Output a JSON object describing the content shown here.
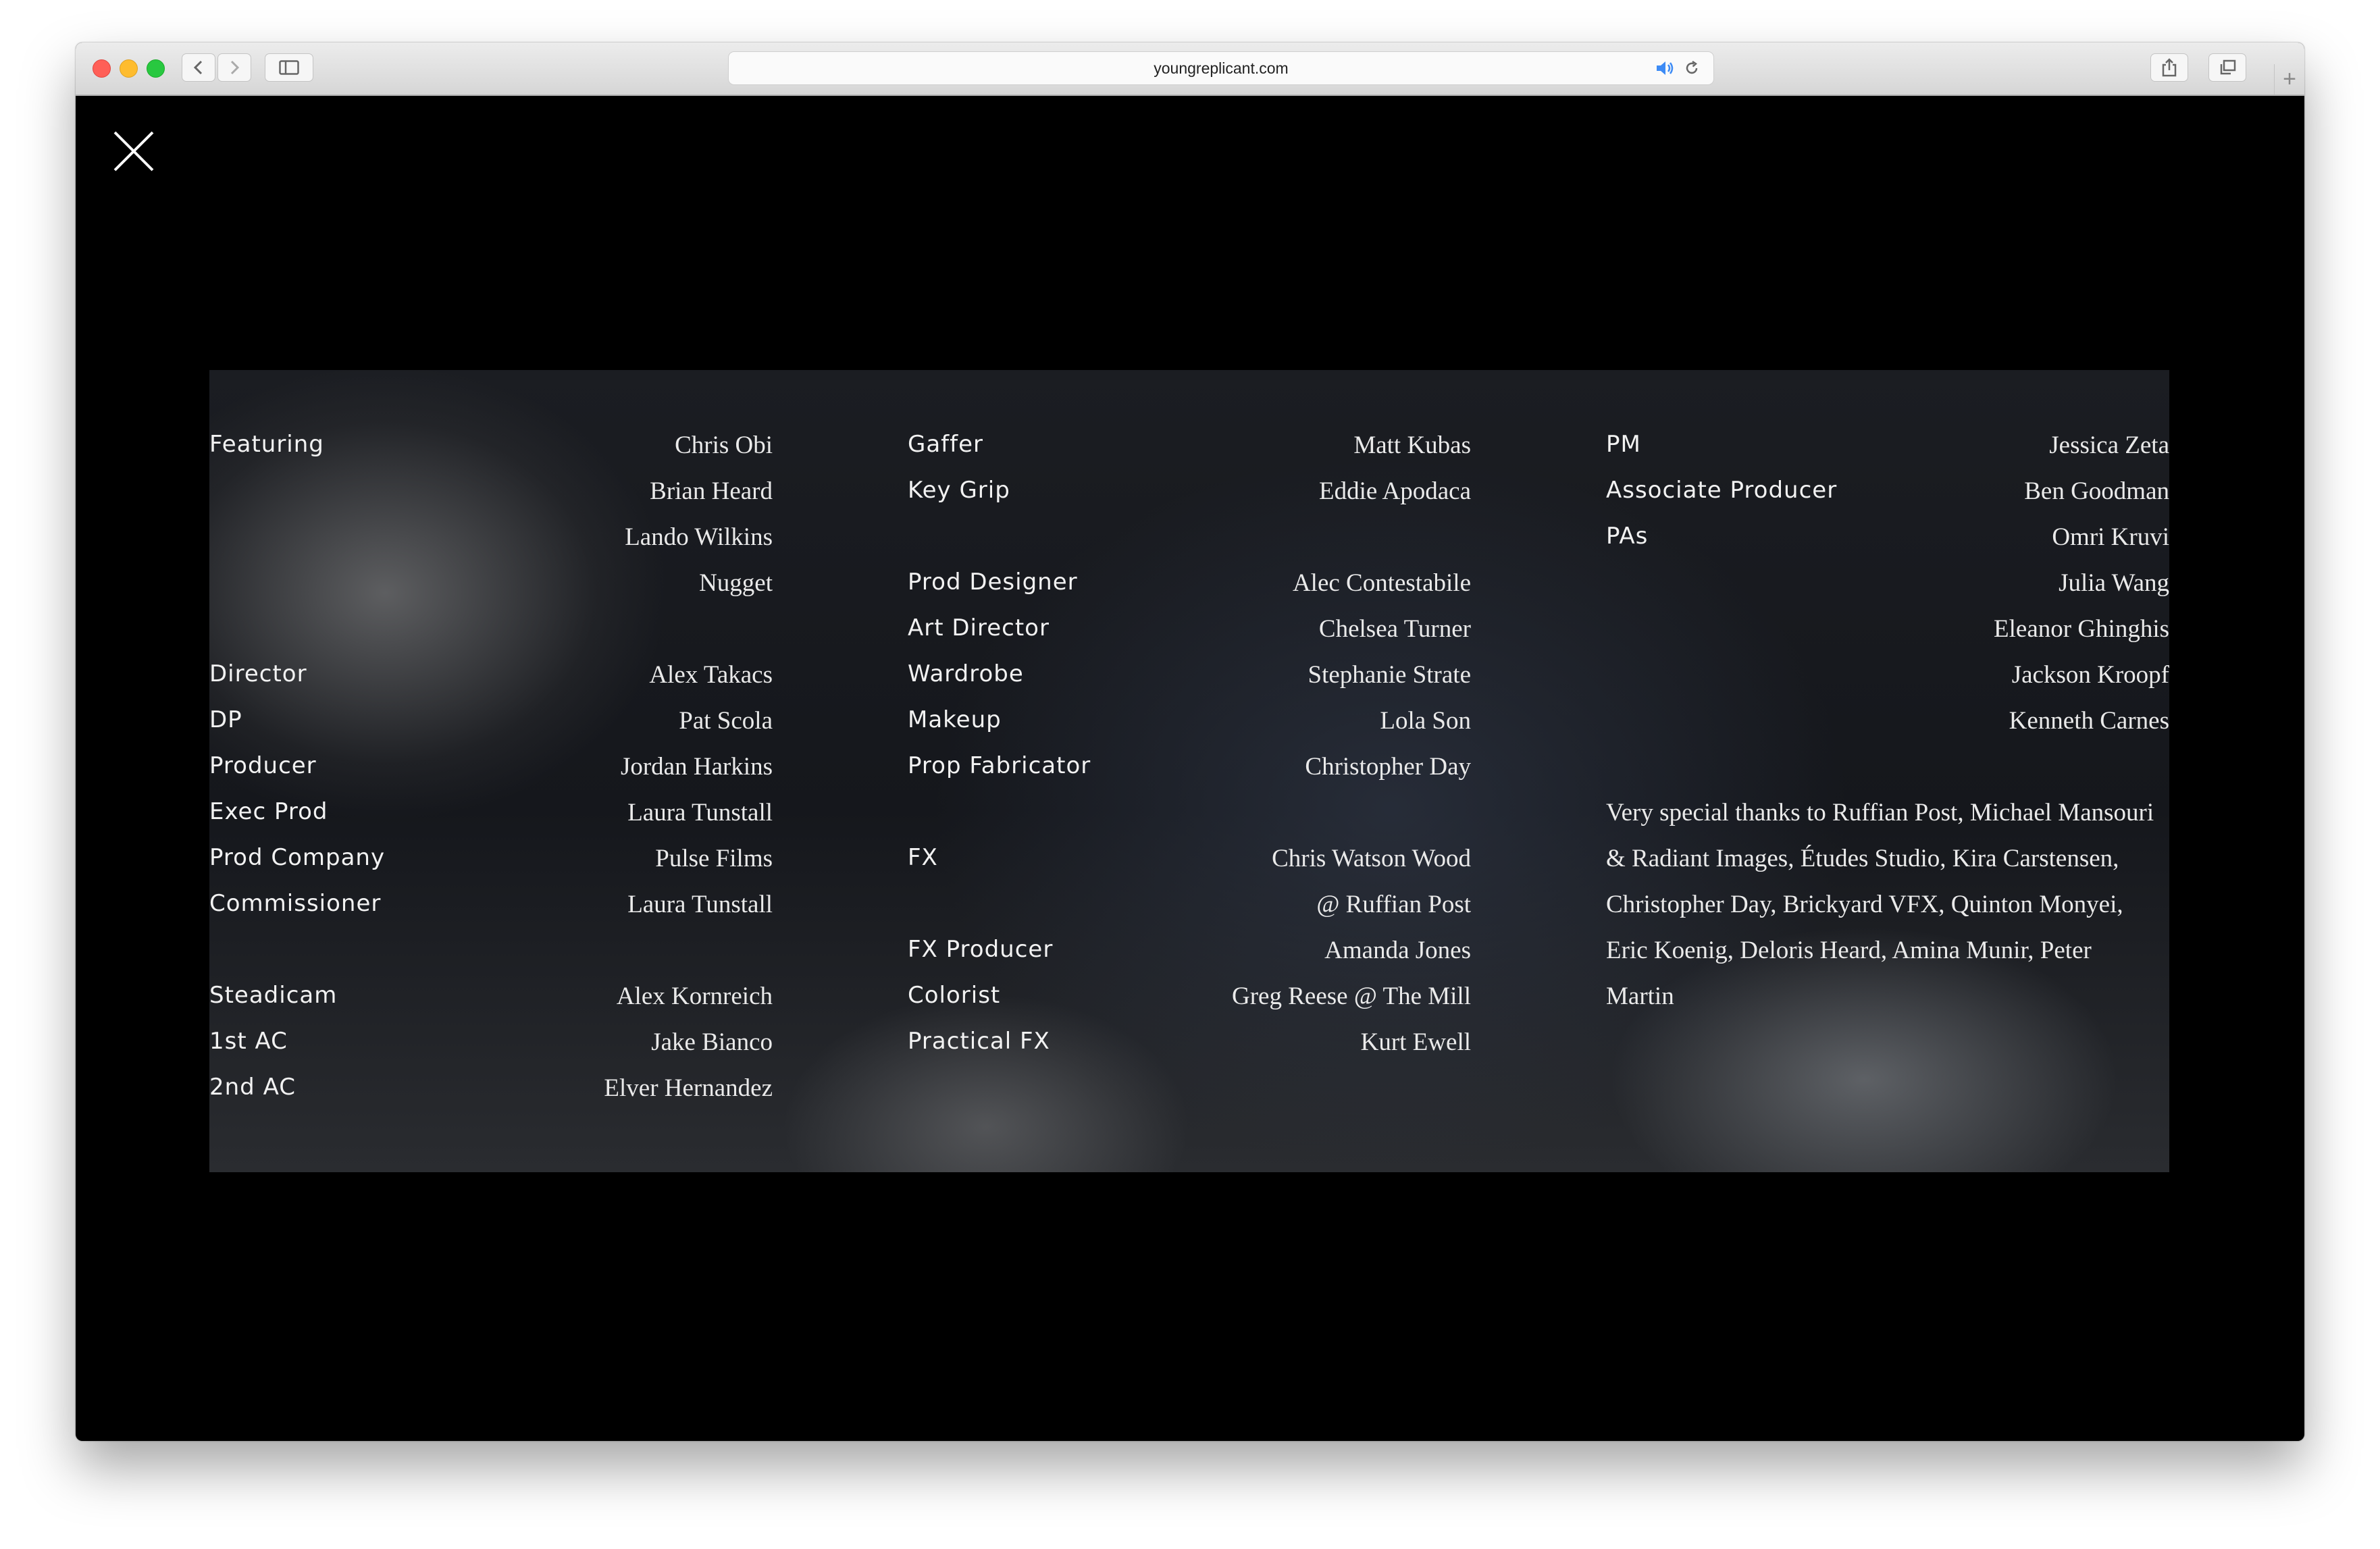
{
  "browser": {
    "url": "youngreplicant.com"
  },
  "credits": {
    "col1": [
      {
        "role": "Featuring",
        "name": "Chris Obi"
      },
      {
        "role": "",
        "name": "Brian Heard"
      },
      {
        "role": "",
        "name": "Lando Wilkins"
      },
      {
        "role": "",
        "name": "Nugget"
      },
      {
        "role": "Director",
        "name": "Alex Takacs"
      },
      {
        "role": "DP",
        "name": "Pat Scola"
      },
      {
        "role": "Producer",
        "name": "Jordan Harkins"
      },
      {
        "role": "Exec Prod",
        "name": "Laura Tunstall"
      },
      {
        "role": "Prod Company",
        "name": "Pulse Films"
      },
      {
        "role": "Commissioner",
        "name": "Laura Tunstall"
      },
      {
        "role": "Steadicam",
        "name": "Alex Kornreich"
      },
      {
        "role": "1st AC",
        "name": "Jake Bianco"
      },
      {
        "role": "2nd AC",
        "name": "Elver Hernandez"
      }
    ],
    "col2": [
      {
        "role": "Gaffer",
        "name": "Matt Kubas"
      },
      {
        "role": "Key Grip",
        "name": "Eddie Apodaca"
      },
      {
        "role": "Prod Designer",
        "name": "Alec Contestabile"
      },
      {
        "role": "Art Director",
        "name": "Chelsea Turner"
      },
      {
        "role": "Wardrobe",
        "name": "Stephanie Strate"
      },
      {
        "role": "Makeup",
        "name": "Lola Son"
      },
      {
        "role": "Prop Fabricator",
        "name": "Christopher Day"
      },
      {
        "role": "FX",
        "name": "Chris Watson Wood"
      },
      {
        "role": "",
        "name": "@ Ruffian Post"
      },
      {
        "role": "FX Producer",
        "name": "Amanda Jones"
      },
      {
        "role": "Colorist",
        "name": "Greg Reese @ The Mill"
      },
      {
        "role": "Practical FX",
        "name": "Kurt Ewell"
      }
    ],
    "col3": [
      {
        "role": "PM",
        "name": "Jessica Zeta"
      },
      {
        "role": "Associate Producer",
        "name": "Ben Goodman"
      },
      {
        "role": "PAs",
        "name": "Omri Kruvi"
      },
      {
        "role": "",
        "name": "Julia Wang"
      },
      {
        "role": "",
        "name": "Eleanor Ghinghis"
      },
      {
        "role": "",
        "name": "Jackson Kroopf"
      },
      {
        "role": "",
        "name": "Kenneth Carnes"
      }
    ],
    "thanks": "Very special thanks to Ruffian Post, Michael Mansouri & Radiant Images, Études Studio, Kira Carstensen, Christopher Day, Brickyard VFX, Quinton Monyei, Eric Koenig, Deloris Heard, Amina Munir, Peter Martin"
  }
}
